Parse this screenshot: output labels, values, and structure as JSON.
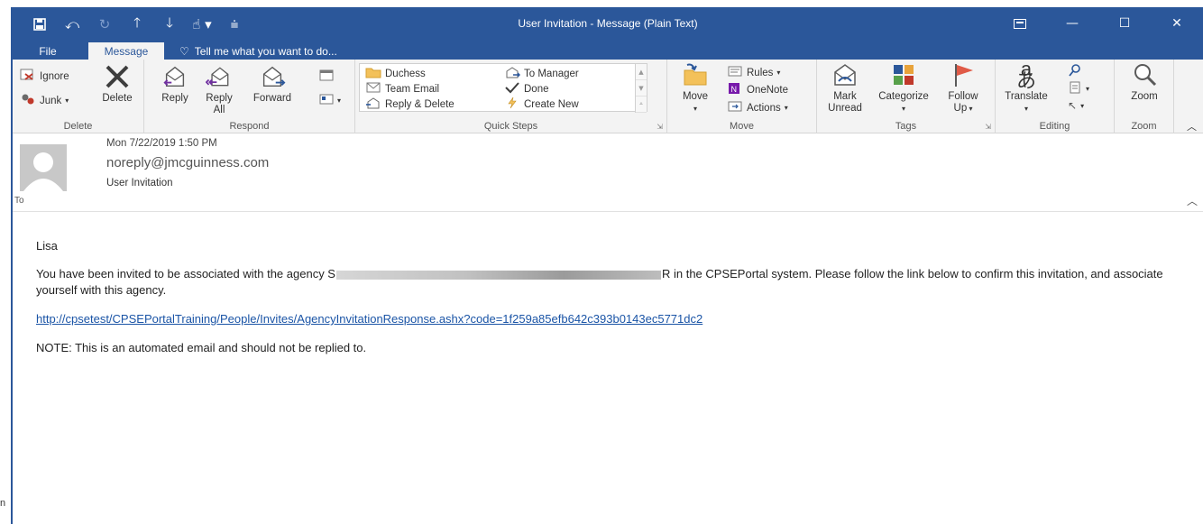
{
  "window": {
    "title": "User Invitation - Message (Plain Text)",
    "accent_color": "#2b579a"
  },
  "quick_access": [
    "save-icon",
    "undo-icon",
    "redo-icon",
    "up-arrow-icon",
    "down-arrow-icon",
    "touch-mode-icon",
    "customize-icon"
  ],
  "tabs": {
    "file": "File",
    "message": "Message",
    "tell_me": "Tell me what you want to do..."
  },
  "ribbon": {
    "delete_group": {
      "label": "Delete",
      "ignore": "Ignore",
      "junk": "Junk",
      "delete": "Delete"
    },
    "respond_group": {
      "label": "Respond",
      "reply": "Reply",
      "reply_all_1": "Reply",
      "reply_all_2": "All",
      "forward": "Forward"
    },
    "quick_steps_group": {
      "label": "Quick Steps",
      "items": [
        "Duchess",
        "Team Email",
        "Reply & Delete",
        "To Manager",
        "Done",
        "Create New"
      ]
    },
    "move_group": {
      "label": "Move",
      "move": "Move",
      "rules": "Rules",
      "onenote": "OneNote",
      "actions": "Actions"
    },
    "tags_group": {
      "label": "Tags",
      "mark_unread_1": "Mark",
      "mark_unread_2": "Unread",
      "categorize": "Categorize",
      "follow_up_1": "Follow",
      "follow_up_2": "Up"
    },
    "editing_group": {
      "label": "Editing",
      "translate": "Translate"
    },
    "zoom_group": {
      "label": "Zoom",
      "zoom": "Zoom"
    }
  },
  "header": {
    "date": "Mon 7/22/2019 1:50 PM",
    "sender": "noreply@jmcguinness.com",
    "subject": "User Invitation",
    "to_label": "To"
  },
  "body": {
    "greeting": "Lisa",
    "para1_start": "You have been invited to be associated with the agency S",
    "para1_end": "R in the CPSEPortal system. Please follow the link below to confirm this invitation, and associate yourself with this agency.",
    "link": "http://cpsetest/CPSEPortalTraining/People/Invites/AgencyInvitationResponse.ashx?code=1f259a85efb642c393b0143ec5771dc2",
    "note": "NOTE: This is an automated email and should not be replied to."
  },
  "edge_text": "n"
}
